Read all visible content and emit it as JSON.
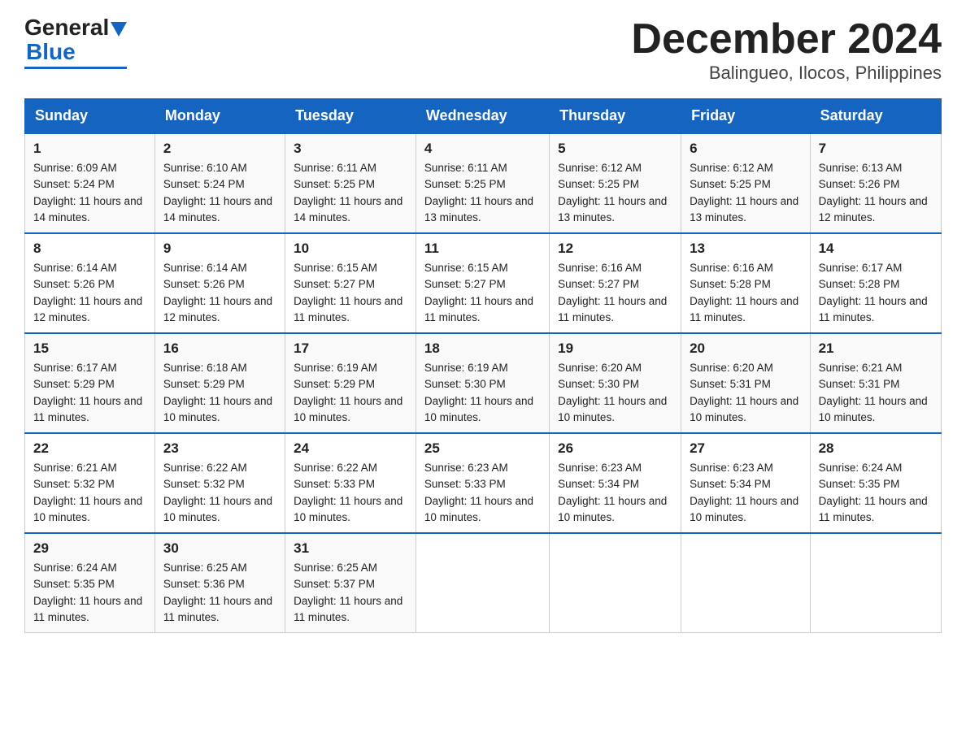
{
  "logo": {
    "general": "General",
    "blue": "Blue"
  },
  "header": {
    "month": "December 2024",
    "location": "Balingueo, Ilocos, Philippines"
  },
  "days_of_week": [
    "Sunday",
    "Monday",
    "Tuesday",
    "Wednesday",
    "Thursday",
    "Friday",
    "Saturday"
  ],
  "weeks": [
    [
      {
        "num": "1",
        "sunrise": "6:09 AM",
        "sunset": "5:24 PM",
        "daylight": "11 hours and 14 minutes."
      },
      {
        "num": "2",
        "sunrise": "6:10 AM",
        "sunset": "5:24 PM",
        "daylight": "11 hours and 14 minutes."
      },
      {
        "num": "3",
        "sunrise": "6:11 AM",
        "sunset": "5:25 PM",
        "daylight": "11 hours and 14 minutes."
      },
      {
        "num": "4",
        "sunrise": "6:11 AM",
        "sunset": "5:25 PM",
        "daylight": "11 hours and 13 minutes."
      },
      {
        "num": "5",
        "sunrise": "6:12 AM",
        "sunset": "5:25 PM",
        "daylight": "11 hours and 13 minutes."
      },
      {
        "num": "6",
        "sunrise": "6:12 AM",
        "sunset": "5:25 PM",
        "daylight": "11 hours and 13 minutes."
      },
      {
        "num": "7",
        "sunrise": "6:13 AM",
        "sunset": "5:26 PM",
        "daylight": "11 hours and 12 minutes."
      }
    ],
    [
      {
        "num": "8",
        "sunrise": "6:14 AM",
        "sunset": "5:26 PM",
        "daylight": "11 hours and 12 minutes."
      },
      {
        "num": "9",
        "sunrise": "6:14 AM",
        "sunset": "5:26 PM",
        "daylight": "11 hours and 12 minutes."
      },
      {
        "num": "10",
        "sunrise": "6:15 AM",
        "sunset": "5:27 PM",
        "daylight": "11 hours and 11 minutes."
      },
      {
        "num": "11",
        "sunrise": "6:15 AM",
        "sunset": "5:27 PM",
        "daylight": "11 hours and 11 minutes."
      },
      {
        "num": "12",
        "sunrise": "6:16 AM",
        "sunset": "5:27 PM",
        "daylight": "11 hours and 11 minutes."
      },
      {
        "num": "13",
        "sunrise": "6:16 AM",
        "sunset": "5:28 PM",
        "daylight": "11 hours and 11 minutes."
      },
      {
        "num": "14",
        "sunrise": "6:17 AM",
        "sunset": "5:28 PM",
        "daylight": "11 hours and 11 minutes."
      }
    ],
    [
      {
        "num": "15",
        "sunrise": "6:17 AM",
        "sunset": "5:29 PM",
        "daylight": "11 hours and 11 minutes."
      },
      {
        "num": "16",
        "sunrise": "6:18 AM",
        "sunset": "5:29 PM",
        "daylight": "11 hours and 10 minutes."
      },
      {
        "num": "17",
        "sunrise": "6:19 AM",
        "sunset": "5:29 PM",
        "daylight": "11 hours and 10 minutes."
      },
      {
        "num": "18",
        "sunrise": "6:19 AM",
        "sunset": "5:30 PM",
        "daylight": "11 hours and 10 minutes."
      },
      {
        "num": "19",
        "sunrise": "6:20 AM",
        "sunset": "5:30 PM",
        "daylight": "11 hours and 10 minutes."
      },
      {
        "num": "20",
        "sunrise": "6:20 AM",
        "sunset": "5:31 PM",
        "daylight": "11 hours and 10 minutes."
      },
      {
        "num": "21",
        "sunrise": "6:21 AM",
        "sunset": "5:31 PM",
        "daylight": "11 hours and 10 minutes."
      }
    ],
    [
      {
        "num": "22",
        "sunrise": "6:21 AM",
        "sunset": "5:32 PM",
        "daylight": "11 hours and 10 minutes."
      },
      {
        "num": "23",
        "sunrise": "6:22 AM",
        "sunset": "5:32 PM",
        "daylight": "11 hours and 10 minutes."
      },
      {
        "num": "24",
        "sunrise": "6:22 AM",
        "sunset": "5:33 PM",
        "daylight": "11 hours and 10 minutes."
      },
      {
        "num": "25",
        "sunrise": "6:23 AM",
        "sunset": "5:33 PM",
        "daylight": "11 hours and 10 minutes."
      },
      {
        "num": "26",
        "sunrise": "6:23 AM",
        "sunset": "5:34 PM",
        "daylight": "11 hours and 10 minutes."
      },
      {
        "num": "27",
        "sunrise": "6:23 AM",
        "sunset": "5:34 PM",
        "daylight": "11 hours and 10 minutes."
      },
      {
        "num": "28",
        "sunrise": "6:24 AM",
        "sunset": "5:35 PM",
        "daylight": "11 hours and 11 minutes."
      }
    ],
    [
      {
        "num": "29",
        "sunrise": "6:24 AM",
        "sunset": "5:35 PM",
        "daylight": "11 hours and 11 minutes."
      },
      {
        "num": "30",
        "sunrise": "6:25 AM",
        "sunset": "5:36 PM",
        "daylight": "11 hours and 11 minutes."
      },
      {
        "num": "31",
        "sunrise": "6:25 AM",
        "sunset": "5:37 PM",
        "daylight": "11 hours and 11 minutes."
      },
      null,
      null,
      null,
      null
    ]
  ]
}
